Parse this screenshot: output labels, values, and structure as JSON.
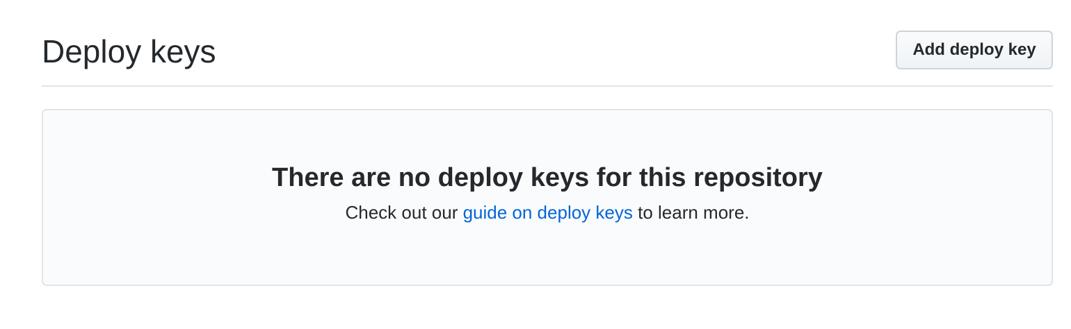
{
  "header": {
    "title": "Deploy keys",
    "add_button_label": "Add deploy key"
  },
  "empty_state": {
    "title": "There are no deploy keys for this repository",
    "text_before": "Check out our ",
    "link_text": "guide on deploy keys",
    "text_after": " to learn more."
  },
  "colors": {
    "text": "#24292e",
    "link": "#0366d6",
    "border": "#e1e4e8",
    "panel_background": "#fafbfc"
  }
}
